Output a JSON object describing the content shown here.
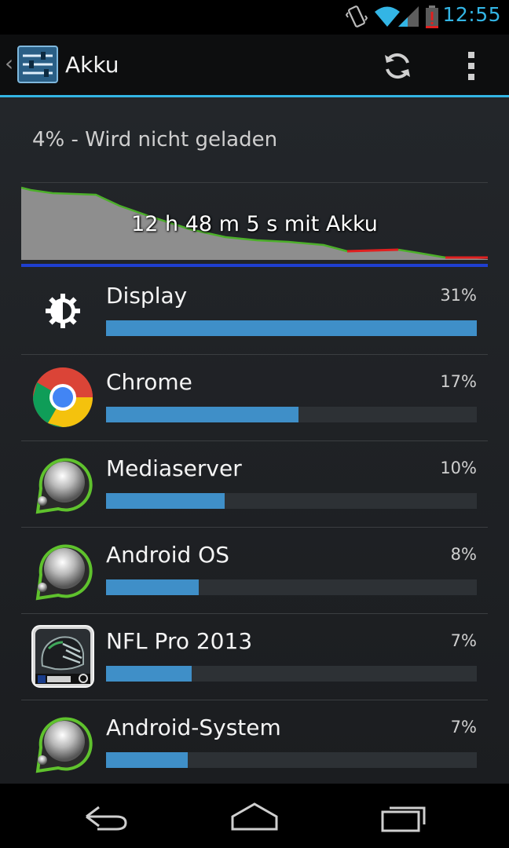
{
  "status_bar": {
    "time": "12:55",
    "icons": [
      "vibrate-icon",
      "wifi-icon",
      "signal-icon",
      "battery-low-icon"
    ]
  },
  "action_bar": {
    "title": "Akku",
    "app_icon": "settings-sliders-icon",
    "actions": [
      "refresh-icon",
      "overflow-menu-icon"
    ]
  },
  "battery": {
    "status": "4% - Wird nicht geladen",
    "graph_label": "12 h 48 m 5 s mit Akku"
  },
  "usage": [
    {
      "name": "Display",
      "percent_label": "31%",
      "fill": 1.0,
      "icon": "brightness-icon"
    },
    {
      "name": "Chrome",
      "percent_label": "17%",
      "fill": 0.52,
      "icon": "chrome-icon"
    },
    {
      "name": "Mediaserver",
      "percent_label": "10%",
      "fill": 0.32,
      "icon": "android-process-icon"
    },
    {
      "name": "Android OS",
      "percent_label": "8%",
      "fill": 0.25,
      "icon": "android-process-icon"
    },
    {
      "name": "NFL Pro 2013",
      "percent_label": "7%",
      "fill": 0.23,
      "icon": "nfl-pro-icon"
    },
    {
      "name": "Android-System",
      "percent_label": "7%",
      "fill": 0.22,
      "icon": "android-process-icon"
    }
  ],
  "colors": {
    "accent": "#33b5e5",
    "bar_fill": "#3f8fc8",
    "graph_line": "#4caf2a",
    "graph_low": "#e02020",
    "graph_charge": "#1f3fd0"
  },
  "nav_bar": {
    "buttons": [
      "back-icon",
      "home-icon",
      "recent-apps-icon"
    ]
  }
}
